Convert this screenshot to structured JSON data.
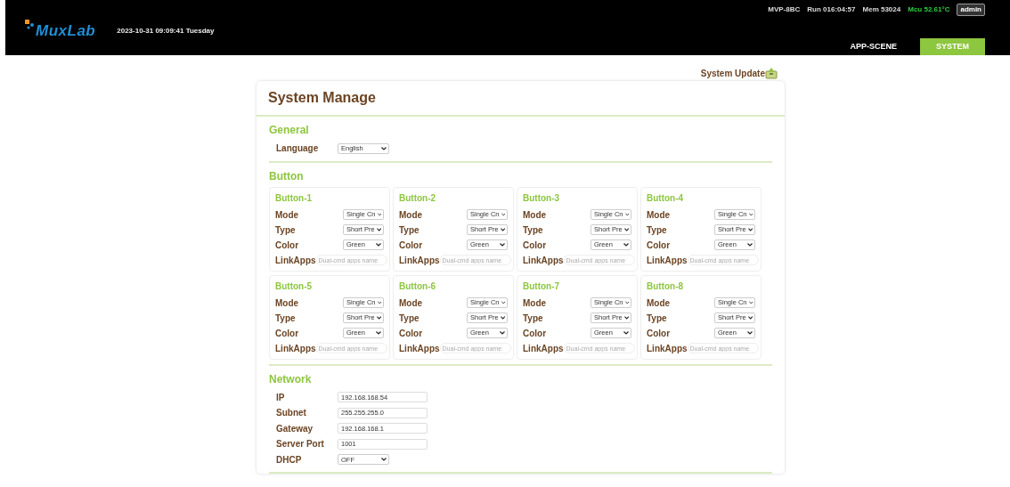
{
  "header": {
    "logo": "MuxLab",
    "date_time": "2023-10-31 09:09:41 Tuesday",
    "status": [
      {
        "text": "MVP-8BC",
        "kind": "plain"
      },
      {
        "text": "Run 016:04:57",
        "kind": "plain"
      },
      {
        "text": "Mem 53024",
        "kind": "plain"
      },
      {
        "text": "Mcu 52.61°C",
        "kind": "alert"
      }
    ],
    "user": "admin",
    "tabs": [
      {
        "label": "APP-SCENE",
        "selected": false
      },
      {
        "label": "SYSTEM",
        "selected": true
      }
    ]
  },
  "system_update": "System Update",
  "panel": {
    "title": "System Manage",
    "sections": [
      {
        "title": "General",
        "kind": "form",
        "fields": [
          {
            "label": "Language",
            "kind": "select",
            "value": "English"
          }
        ]
      },
      {
        "title": "Button",
        "kind": "grid",
        "buttons": [
          {
            "title": "Button-1",
            "fields": [
              {
                "label": "Mode",
                "kind": "select",
                "value": "Single Cn"
              },
              {
                "label": "Type",
                "kind": "select",
                "value": "Short Pre"
              },
              {
                "label": "Color",
                "kind": "select",
                "value": "Green"
              },
              {
                "label": "LinkApps",
                "kind": "text",
                "placeholder": "Dual-cmd apps name"
              }
            ]
          },
          {
            "title": "Button-2",
            "fields": [
              {
                "label": "Mode",
                "kind": "select",
                "value": "Single Cn"
              },
              {
                "label": "Type",
                "kind": "select",
                "value": "Short Pre"
              },
              {
                "label": "Color",
                "kind": "select",
                "value": "Green"
              },
              {
                "label": "LinkApps",
                "kind": "text",
                "placeholder": "Dual-cmd apps name"
              }
            ]
          },
          {
            "title": "Button-3",
            "fields": [
              {
                "label": "Mode",
                "kind": "select",
                "value": "Single Cn"
              },
              {
                "label": "Type",
                "kind": "select",
                "value": "Short Pre"
              },
              {
                "label": "Color",
                "kind": "select",
                "value": "Green"
              },
              {
                "label": "LinkApps",
                "kind": "text",
                "placeholder": "Dual-cmd apps name"
              }
            ]
          },
          {
            "title": "Button-4",
            "fields": [
              {
                "label": "Mode",
                "kind": "select",
                "value": "Single Cn"
              },
              {
                "label": "Type",
                "kind": "select",
                "value": "Short Pre"
              },
              {
                "label": "Color",
                "kind": "select",
                "value": "Green"
              },
              {
                "label": "LinkApps",
                "kind": "text",
                "placeholder": "Dual-cmd apps name"
              }
            ]
          },
          {
            "title": "Button-5",
            "fields": [
              {
                "label": "Mode",
                "kind": "select",
                "value": "Single Cn"
              },
              {
                "label": "Type",
                "kind": "select",
                "value": "Short Pre"
              },
              {
                "label": "Color",
                "kind": "select",
                "value": "Green"
              },
              {
                "label": "LinkApps",
                "kind": "text",
                "placeholder": "Dual-cmd apps name"
              }
            ]
          },
          {
            "title": "Button-6",
            "fields": [
              {
                "label": "Mode",
                "kind": "select",
                "value": "Single Cn"
              },
              {
                "label": "Type",
                "kind": "select",
                "value": "Short Pre"
              },
              {
                "label": "Color",
                "kind": "select",
                "value": "Green"
              },
              {
                "label": "LinkApps",
                "kind": "text",
                "placeholder": "Dual-cmd apps name"
              }
            ]
          },
          {
            "title": "Button-7",
            "fields": [
              {
                "label": "Mode",
                "kind": "select",
                "value": "Single Cn"
              },
              {
                "label": "Type",
                "kind": "select",
                "value": "Short Pre"
              },
              {
                "label": "Color",
                "kind": "select",
                "value": "Green"
              },
              {
                "label": "LinkApps",
                "kind": "text",
                "placeholder": "Dual-cmd apps name"
              }
            ]
          },
          {
            "title": "Button-8",
            "fields": [
              {
                "label": "Mode",
                "kind": "select",
                "value": "Single Cn"
              },
              {
                "label": "Type",
                "kind": "select",
                "value": "Short Pre"
              },
              {
                "label": "Color",
                "kind": "select",
                "value": "Green"
              },
              {
                "label": "LinkApps",
                "kind": "text",
                "placeholder": "Dual-cmd apps name"
              }
            ]
          }
        ]
      },
      {
        "title": "Network",
        "kind": "form",
        "fields": [
          {
            "label": "IP",
            "kind": "text",
            "value": "192.168.168.54"
          },
          {
            "label": "Subnet",
            "kind": "text",
            "value": "255.255.255.0"
          },
          {
            "label": "Gateway",
            "kind": "text",
            "value": "192.168.168.1"
          },
          {
            "label": "Server Port",
            "kind": "text",
            "value": "1001"
          },
          {
            "label": "DHCP",
            "kind": "select",
            "value": "OFF"
          }
        ]
      }
    ]
  }
}
